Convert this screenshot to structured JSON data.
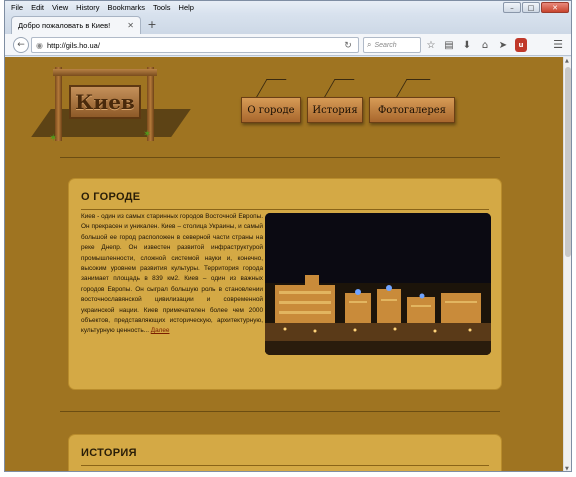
{
  "browser": {
    "menu": [
      "File",
      "Edit",
      "View",
      "History",
      "Bookmarks",
      "Tools",
      "Help"
    ],
    "tab_title": "Добро пожаловать в Киев!",
    "url": "http://gils.ho.ua/",
    "search_placeholder": "Search"
  },
  "site": {
    "logo_text": "Киев",
    "nav": [
      "О городе",
      "История",
      "Фотогалерея"
    ]
  },
  "section_about": {
    "title": "О ГОРОДЕ",
    "text": "Киев - один из самых старинных городов Восточной Европы. Он прекрасен и уникален. Киев – столица Украины, и самый большой ее город расположен в северной части страны на реке Днепр. Он известен развитой инфраструктурой промышленности, сложной системой науки и, конечно, высоким уровнем развития культуры. Территория города занимает площадь в 839 км2. Киев – один из важных городов Европы. Он сыграл большую роль в становлении восточнославянской цивилизации и современной украинской нации. Киев примечателен более чем 2000 объектов, представляющих историческую, архитектурную, культурную ценность...",
    "more": "Далее"
  },
  "section_history": {
    "title": "ИСТОРИЯ"
  }
}
